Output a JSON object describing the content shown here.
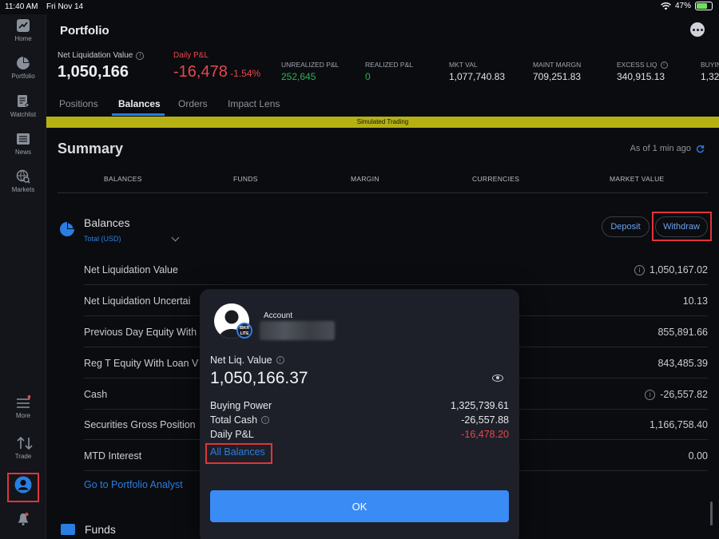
{
  "status_bar": {
    "time": "11:40 AM",
    "date": "Fri Nov 14",
    "battery": "47%"
  },
  "sidebar": {
    "items": [
      {
        "label": "Home",
        "icon": "home-chart-icon"
      },
      {
        "label": "Portfolio",
        "icon": "pie-chart-icon"
      },
      {
        "label": "Watchlist",
        "icon": "watchlist-icon"
      },
      {
        "label": "News",
        "icon": "news-icon"
      },
      {
        "label": "Markets",
        "icon": "markets-globe-icon"
      },
      {
        "label": "More",
        "icon": "hamburger-menu-icon"
      },
      {
        "label": "Trade",
        "icon": "trade-arrows-icon"
      },
      {
        "label": "",
        "icon": "account-avatar-icon"
      },
      {
        "label": "",
        "icon": "bell-icon"
      }
    ]
  },
  "header": {
    "title": "Portfolio"
  },
  "metrics": {
    "net_liq": {
      "label": "Net Liquidation Value",
      "value": "1,050,166"
    },
    "daily_pnl": {
      "label": "Daily P&L",
      "value": "-16,478",
      "pct": "-1.54%"
    },
    "unrealized": {
      "label": "UNREALIZED P&L",
      "value": "252,645"
    },
    "realized": {
      "label": "REALIZED P&L",
      "value": "0"
    },
    "mkt_val": {
      "label": "MKT VAL",
      "value": "1,077,740.83"
    },
    "maint_margin": {
      "label": "MAINT MARGN",
      "value": "709,251.83"
    },
    "excess_liq": {
      "label": "EXCESS LIQ",
      "value": "340,915.13"
    },
    "buying": {
      "label": "BUYIN",
      "value": "1,32"
    }
  },
  "tabs": [
    "Positions",
    "Balances",
    "Orders",
    "Impact Lens"
  ],
  "banner": "Simulated Trading",
  "summary": {
    "title": "Summary",
    "as_of": "As of 1 min ago",
    "category_tabs": [
      "BALANCES",
      "FUNDS",
      "MARGIN",
      "CURRENCIES",
      "MARKET VALUE"
    ]
  },
  "balances": {
    "title": "Balances",
    "subtitle": "Total (USD)",
    "deposit": "Deposit",
    "withdraw": "Withdraw",
    "rows": [
      {
        "label": "Net Liquidation Value",
        "value": "1,050,167.02"
      },
      {
        "label": "Net Liquidation Uncertai",
        "value": "10.13"
      },
      {
        "label": "Previous Day Equity With",
        "value": "855,891.66"
      },
      {
        "label": "Reg T Equity With Loan V",
        "value": "843,485.39"
      },
      {
        "label": "Cash",
        "value": "-26,557.82"
      },
      {
        "label": "Securities Gross Position",
        "value": "1,166,758.40"
      },
      {
        "label": "MTD Interest",
        "value": "0.00"
      }
    ],
    "analyst_link": "Go to Portfolio Analyst"
  },
  "funds": {
    "title": "Funds"
  },
  "modal": {
    "account_label": "Account",
    "badge_text": "IBKR LITE",
    "net_liq_label": "Net Liq. Value",
    "net_liq_value": "1,050,166.37",
    "buying_power_label": "Buying Power",
    "buying_power_value": "1,325,739.61",
    "total_cash_label": "Total Cash",
    "total_cash_value": "-26,557.88",
    "daily_pnl_label": "Daily P&L",
    "daily_pnl_value": "-16,478.20",
    "all_balances": "All Balances",
    "ok": "OK"
  },
  "colors": {
    "accent": "#2a7de1",
    "negative": "#e5484d",
    "positive": "#2fae5b",
    "banner": "#b6b113",
    "highlight": "#e0353a"
  }
}
